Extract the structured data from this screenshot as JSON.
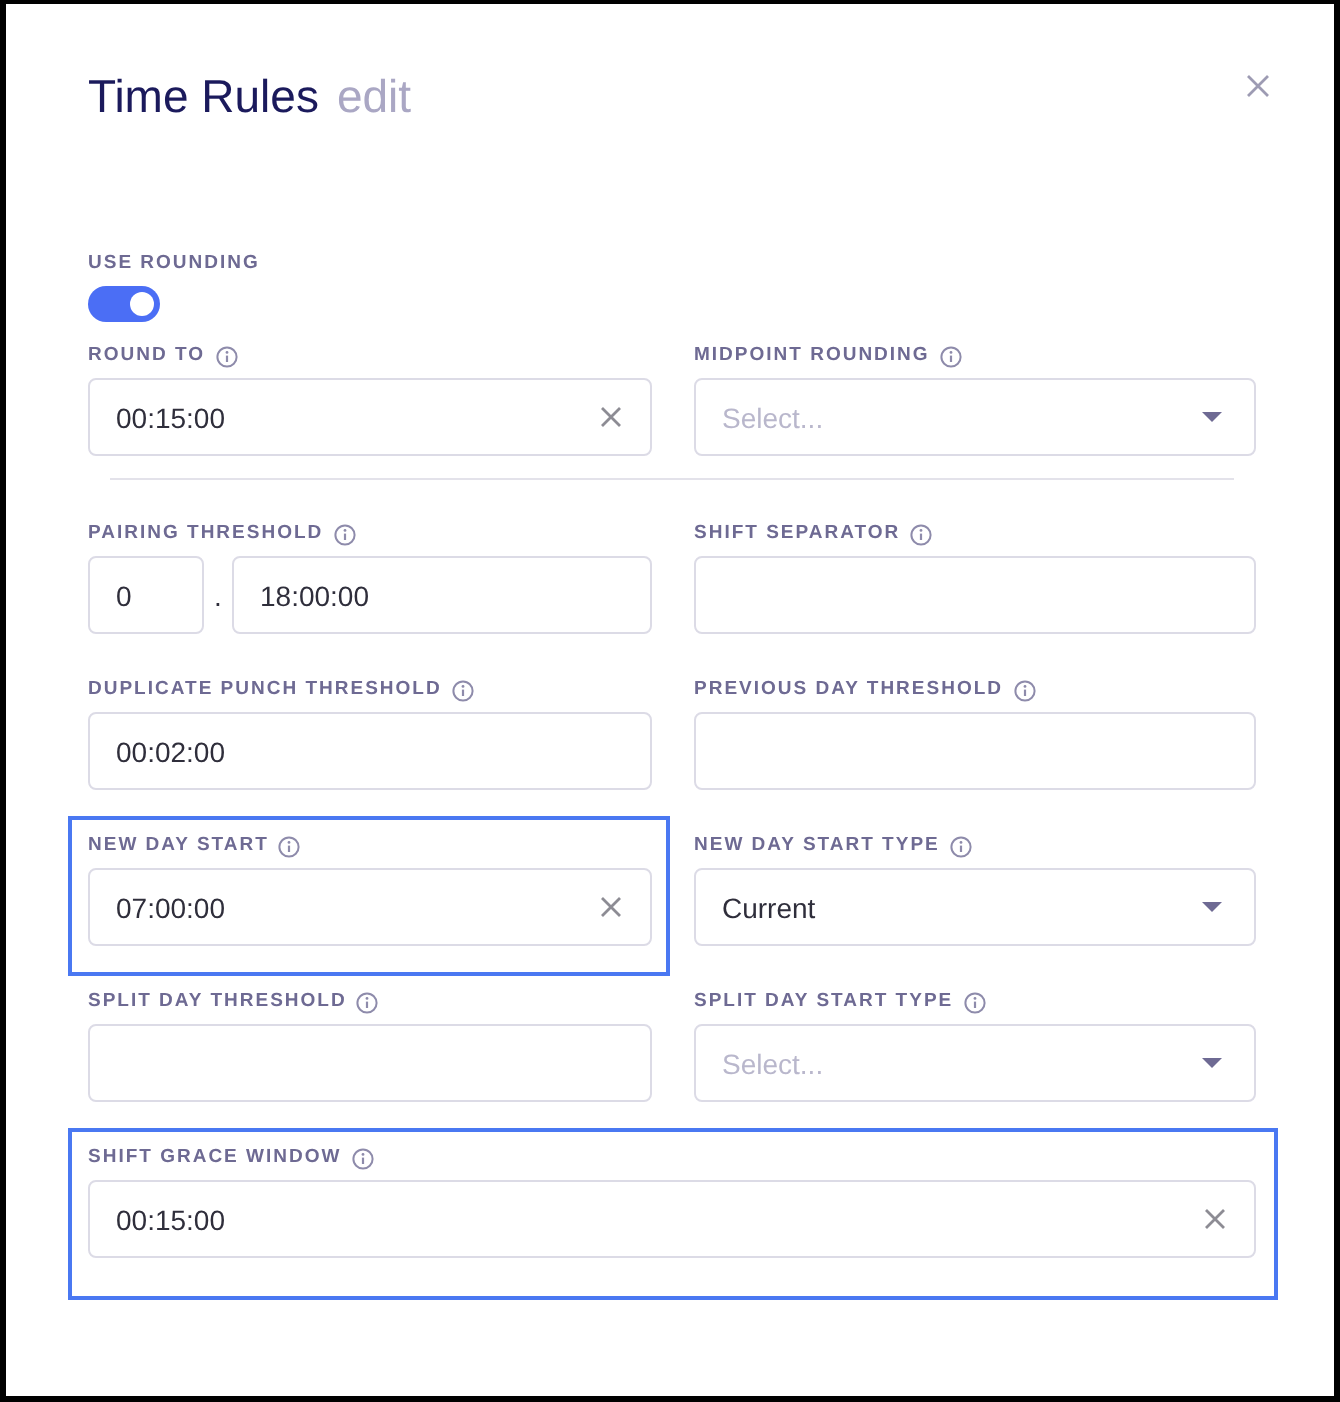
{
  "dialog": {
    "title": "Time Rules",
    "subtitle": "edit"
  },
  "toggle": {
    "label": "USE ROUNDING",
    "on": true
  },
  "sections": [
    {
      "rows": [
        [
          {
            "kind": "text",
            "label": "ROUND TO",
            "value": "00:15:00",
            "clearable": true,
            "highlighted": false
          },
          {
            "kind": "select",
            "label": "MIDPOINT ROUNDING",
            "placeholder": "Select...",
            "highlighted": false
          }
        ]
      ]
    },
    {
      "rows": [
        [
          {
            "kind": "split",
            "label": "PAIRING THRESHOLD",
            "days": "0",
            "separator": ".",
            "value": "18:00:00",
            "clearable": false,
            "highlighted": false
          },
          {
            "kind": "text",
            "label": "SHIFT SEPARATOR",
            "clearable": false,
            "highlighted": false
          }
        ],
        [
          {
            "kind": "text",
            "label": "DUPLICATE PUNCH THRESHOLD",
            "value": "00:02:00",
            "clearable": false,
            "highlighted": false
          },
          {
            "kind": "text",
            "label": "PREVIOUS DAY THRESHOLD",
            "clearable": false,
            "highlighted": false
          }
        ],
        [
          {
            "kind": "text",
            "label": "NEW DAY START",
            "value": "07:00:00",
            "clearable": true,
            "highlighted": true
          },
          {
            "kind": "select",
            "label": "NEW DAY START TYPE",
            "value": "Current",
            "highlighted": false
          }
        ],
        [
          {
            "kind": "text",
            "label": "SPLIT DAY THRESHOLD",
            "clearable": false,
            "highlighted": false
          },
          {
            "kind": "select",
            "label": "SPLIT DAY START TYPE",
            "placeholder": "Select...",
            "highlighted": false
          }
        ],
        [
          {
            "kind": "text",
            "label": "SHIFT GRACE WINDOW",
            "value": "00:15:00",
            "clearable": true,
            "highlighted": true
          }
        ]
      ]
    }
  ]
}
